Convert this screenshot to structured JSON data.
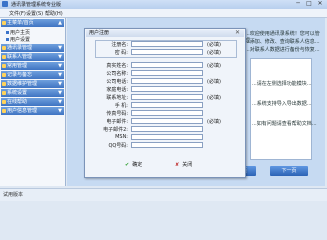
{
  "window": {
    "title": "通讯录管理系统专业版",
    "min": "─",
    "max": "□",
    "close": "✕"
  },
  "menu": [
    "文件(F)",
    "设置(S)",
    "帮助(H)"
  ],
  "sidebar": {
    "sections": [
      {
        "label": "主菜单/首页",
        "subitems": [
          "用户主页",
          "用户设置"
        ]
      },
      {
        "label": "通讯录管理",
        "subitems": []
      },
      {
        "label": "联系人管理",
        "subitems": []
      },
      {
        "label": "常用管理",
        "subitems": []
      },
      {
        "label": "记录与备忘",
        "subitems": []
      },
      {
        "label": "数据维护管理",
        "subitems": []
      },
      {
        "label": "系统设置",
        "subitems": []
      },
      {
        "label": "在线帮助",
        "subitems": []
      },
      {
        "label": "用户信息管理",
        "subitems": []
      }
    ]
  },
  "background": {
    "lines": [
      "...欢迎使用通讯录系统！您可以管理...",
      "...添加、修改、查询联系人信息...",
      "...对联系人数据进行备份与恢复...",
      "...请在左侧选择功能模块...",
      "...系统支持导入导出数据...",
      "...如有问题请查看帮助文档..."
    ],
    "prev_label": "返回首页",
    "next_label": "下一页"
  },
  "dialog": {
    "title": "用户注册",
    "close": "✕",
    "top_fields": [
      {
        "label": "注册名:",
        "note": "(必填)"
      },
      {
        "label": "密  码:",
        "note": "(必填)"
      }
    ],
    "fields": [
      {
        "label": "真实姓名:",
        "note": "(必填)"
      },
      {
        "label": "公司名称:",
        "note": ""
      },
      {
        "label": "公司电话:",
        "note": "(必填)"
      },
      {
        "label": "家庭电话:",
        "note": ""
      },
      {
        "label": "联系地址:",
        "note": "(必填)"
      },
      {
        "label": "手  机:",
        "note": ""
      },
      {
        "label": "传真号码:",
        "note": ""
      },
      {
        "label": "电子邮件:",
        "note": "(必填)"
      },
      {
        "label": "电子邮件2:",
        "note": ""
      },
      {
        "label": "MSN:",
        "note": ""
      },
      {
        "label": "QQ号码:",
        "note": ""
      }
    ],
    "ok_label": "确定",
    "close_label": "关闭",
    "ok_icon": "✔",
    "close_icon": "✘"
  },
  "status": {
    "text": "试用版本"
  }
}
